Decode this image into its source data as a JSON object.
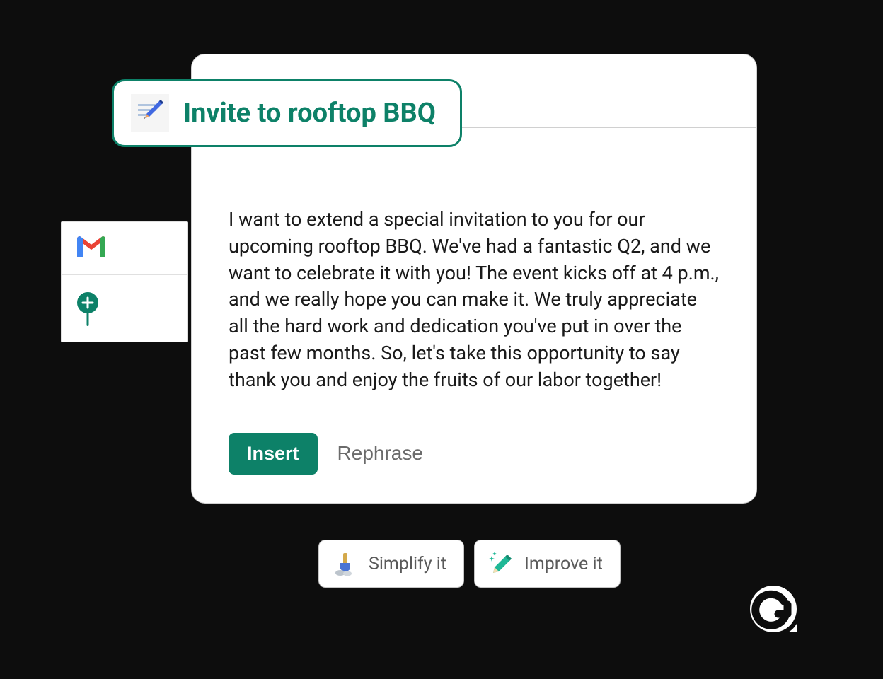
{
  "title_pill": {
    "label": "Invite to rooftop BBQ"
  },
  "body_text": "I want to extend a special invitation to you for our upcoming rooftop BBQ. We've had a fantastic Q2, and we want to celebrate it with you! The event kicks off at 4 p.m., and we really hope you can make it. We truly appreciate all the hard work and dedication you've put in over the past few months. So, let's take this opportunity to say thank you and enjoy the fruits of our labor together!",
  "actions": {
    "insert_label": "Insert",
    "rephrase_label": "Rephrase"
  },
  "floating_actions": {
    "simplify_label": "Simplify it",
    "improve_label": "Improve it"
  },
  "icons": {
    "pen": "pen-writing-icon",
    "gmail": "gmail-icon",
    "add": "add-icon",
    "brush": "brush-icon",
    "sparkle_pencil": "sparkle-pencil-icon",
    "grammarly": "grammarly-icon"
  },
  "colors": {
    "accent": "#0d8168",
    "dark_bg": "#0d0d0d",
    "card_bg": "#ffffff",
    "text_primary": "#1a1a1a",
    "text_secondary": "#6b6b6b"
  }
}
